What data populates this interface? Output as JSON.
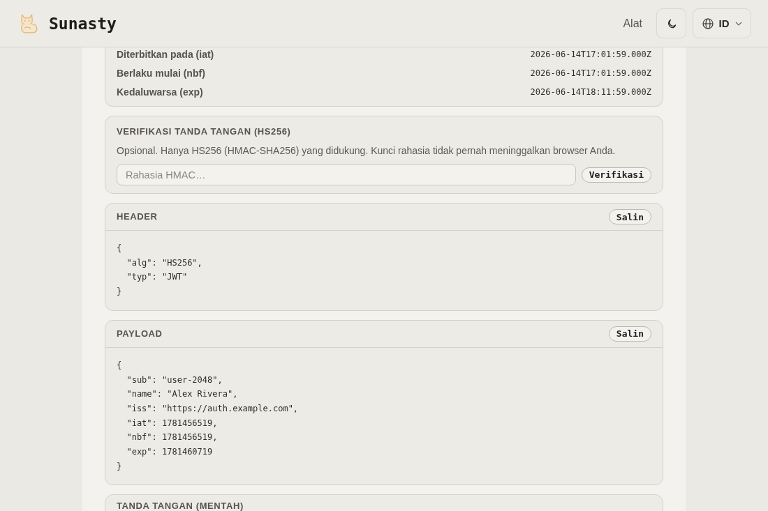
{
  "header": {
    "brand": "Sunasty",
    "nav_link": "Alat",
    "language": "ID"
  },
  "time_claims": [
    {
      "label": "Diterbitkan pada (iat)",
      "value": "2026-06-14T17:01:59.000Z"
    },
    {
      "label": "Berlaku mulai (nbf)",
      "value": "2026-06-14T17:01:59.000Z"
    },
    {
      "label": "Kedaluwarsa (exp)",
      "value": "2026-06-14T18:11:59.000Z"
    }
  ],
  "verification": {
    "title": "VERIFIKASI TANDA TANGAN (HS256)",
    "description": "Opsional. Hanya HS256 (HMAC-SHA256) yang didukung. Kunci rahasia tidak pernah meninggalkan browser Anda.",
    "secret_field": {
      "placeholder": "Rahasia HMAC…"
    },
    "button": "Verifikasi"
  },
  "sections": [
    {
      "title": "HEADER",
      "copy_button": "Salin",
      "code_lines": [
        "{",
        "  \"alg\": \"HS256\",",
        "  \"typ\": \"JWT\"",
        "}"
      ]
    },
    {
      "title": "PAYLOAD",
      "copy_button": "Salin",
      "code_lines": [
        "{",
        "  \"sub\": \"user-2048\",",
        "  \"name\": \"Alex Rivera\",",
        "  \"iss\": \"https://auth.example.com\",",
        "  \"iat\": 1781456519,",
        "  \"nbf\": 1781456519,",
        "  \"exp\": 1781460719",
        "}"
      ]
    }
  ],
  "raw_signature": {
    "title": "TANDA TANGAN (MENTAH)"
  }
}
